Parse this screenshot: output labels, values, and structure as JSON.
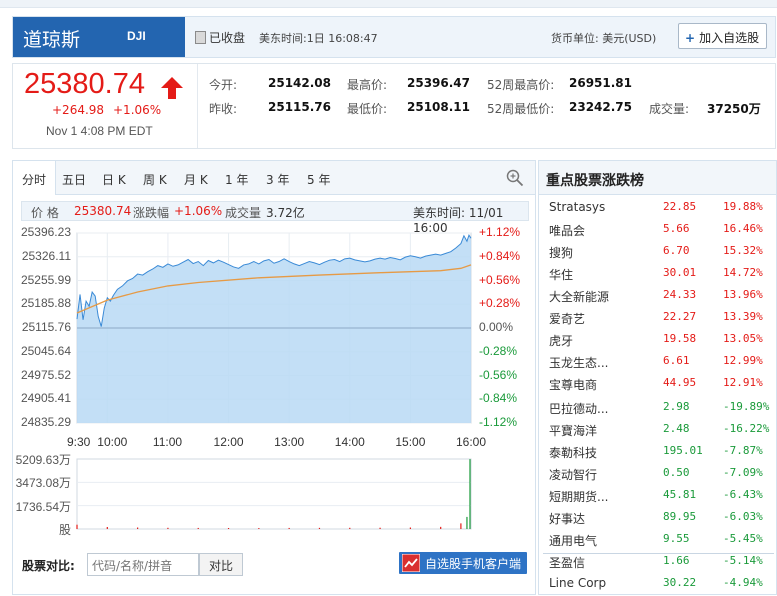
{
  "header": {
    "name": "道琼斯",
    "symbol": "DJI",
    "status": "已收盘",
    "time": "美东时间:1日 16:08:47",
    "currency": "货币单位: 美元(USD)",
    "add_button": "加入自选股"
  },
  "quote": {
    "price": "25380.74",
    "change": "+264.98",
    "change_pct": "+1.06%",
    "date": "Nov 1 4:08 PM EDT",
    "stats": [
      {
        "label": "今开:",
        "value": "25142.08"
      },
      {
        "label": "最高价:",
        "value": "25396.47"
      },
      {
        "label": "52周最高价:",
        "value": "26951.81"
      },
      {
        "label": "昨收:",
        "value": "25115.76"
      },
      {
        "label": "最低价:",
        "value": "25108.11"
      },
      {
        "label": "52周最低价:",
        "value": "23242.75"
      },
      {
        "label": "成交量:",
        "value": "37250万"
      }
    ]
  },
  "tabs": [
    "分时",
    "五日",
    "日 K",
    "周 K",
    "月 K",
    "1 年",
    "3 年",
    "5 年"
  ],
  "infobar": {
    "price_label": "价 格",
    "price": "25380.74",
    "chg_label": "涨跌幅",
    "chg": "+1.06%",
    "vol_label": "成交量",
    "vol": "3.72亿",
    "time": "美东时间: 11/01 16:00"
  },
  "chart_data": {
    "type": "area",
    "x_ticks": [
      "9:30",
      "10:00",
      "11:00",
      "12:00",
      "13:00",
      "14:00",
      "15:00",
      "16:00"
    ],
    "y_ticks": [
      "25396.23",
      "25326.11",
      "25255.99",
      "25185.88",
      "25115.76",
      "25045.64",
      "24975.52",
      "24905.41",
      "24835.29"
    ],
    "pct_ticks": [
      "+1.12%",
      "+0.84%",
      "+0.56%",
      "+0.28%",
      "0.00%",
      "-0.28%",
      "-0.56%",
      "-0.84%",
      "-1.12%"
    ],
    "ylim": [
      24835.29,
      25396.23
    ],
    "prev_close": 25115.76,
    "colors": {
      "up": "#e41b17",
      "down": "#1a9a3a",
      "fill": "#b8d9f5",
      "line": "#3a8ad6",
      "avg": "#e69a45"
    },
    "price_series": [
      {
        "t": 0,
        "v": 25142
      },
      {
        "t": 3,
        "v": 25215
      },
      {
        "t": 6,
        "v": 25140
      },
      {
        "t": 9,
        "v": 25195
      },
      {
        "t": 12,
        "v": 25180
      },
      {
        "t": 15,
        "v": 25222
      },
      {
        "t": 18,
        "v": 25210
      },
      {
        "t": 21,
        "v": 25150
      },
      {
        "t": 24,
        "v": 25120
      },
      {
        "t": 27,
        "v": 25175
      },
      {
        "t": 30,
        "v": 25205
      },
      {
        "t": 33,
        "v": 25195
      },
      {
        "t": 36,
        "v": 25212
      },
      {
        "t": 40,
        "v": 25230
      },
      {
        "t": 45,
        "v": 25240
      },
      {
        "t": 50,
        "v": 25255
      },
      {
        "t": 55,
        "v": 25262
      },
      {
        "t": 60,
        "v": 25275
      },
      {
        "t": 65,
        "v": 25272
      },
      {
        "t": 70,
        "v": 25282
      },
      {
        "t": 75,
        "v": 25290
      },
      {
        "t": 80,
        "v": 25300
      },
      {
        "t": 85,
        "v": 25295
      },
      {
        "t": 90,
        "v": 25305
      },
      {
        "t": 95,
        "v": 25298
      },
      {
        "t": 100,
        "v": 25302
      },
      {
        "t": 105,
        "v": 25310
      },
      {
        "t": 110,
        "v": 25318
      },
      {
        "t": 115,
        "v": 25306
      },
      {
        "t": 120,
        "v": 25312
      },
      {
        "t": 125,
        "v": 25300
      },
      {
        "t": 130,
        "v": 25315
      },
      {
        "t": 135,
        "v": 25308
      },
      {
        "t": 140,
        "v": 25316
      },
      {
        "t": 145,
        "v": 25310
      },
      {
        "t": 150,
        "v": 25303
      },
      {
        "t": 155,
        "v": 25296
      },
      {
        "t": 160,
        "v": 25292
      },
      {
        "t": 165,
        "v": 25302
      },
      {
        "t": 170,
        "v": 25305
      },
      {
        "t": 175,
        "v": 25312
      },
      {
        "t": 180,
        "v": 25305
      },
      {
        "t": 185,
        "v": 25314
      },
      {
        "t": 190,
        "v": 25318
      },
      {
        "t": 195,
        "v": 25307
      },
      {
        "t": 200,
        "v": 25312
      },
      {
        "t": 205,
        "v": 25320
      },
      {
        "t": 210,
        "v": 25312
      },
      {
        "t": 215,
        "v": 25305
      },
      {
        "t": 220,
        "v": 25300
      },
      {
        "t": 225,
        "v": 25306
      },
      {
        "t": 230,
        "v": 25312
      },
      {
        "t": 235,
        "v": 25308
      },
      {
        "t": 240,
        "v": 25303
      },
      {
        "t": 245,
        "v": 25310
      },
      {
        "t": 250,
        "v": 25316
      },
      {
        "t": 255,
        "v": 25318
      },
      {
        "t": 260,
        "v": 25312
      },
      {
        "t": 265,
        "v": 25320
      },
      {
        "t": 270,
        "v": 25322
      },
      {
        "t": 275,
        "v": 25317
      },
      {
        "t": 280,
        "v": 25314
      },
      {
        "t": 285,
        "v": 25311
      },
      {
        "t": 290,
        "v": 25314
      },
      {
        "t": 295,
        "v": 25319
      },
      {
        "t": 300,
        "v": 25322
      },
      {
        "t": 305,
        "v": 25319
      },
      {
        "t": 310,
        "v": 25324
      },
      {
        "t": 315,
        "v": 25321
      },
      {
        "t": 320,
        "v": 25317
      },
      {
        "t": 325,
        "v": 25325
      },
      {
        "t": 330,
        "v": 25329
      },
      {
        "t": 335,
        "v": 25326
      },
      {
        "t": 340,
        "v": 25322
      },
      {
        "t": 345,
        "v": 25328
      },
      {
        "t": 350,
        "v": 25331
      },
      {
        "t": 355,
        "v": 25334
      },
      {
        "t": 360,
        "v": 25331
      },
      {
        "t": 365,
        "v": 25336
      },
      {
        "t": 370,
        "v": 25341
      },
      {
        "t": 375,
        "v": 25352
      },
      {
        "t": 380,
        "v": 25365
      },
      {
        "t": 383,
        "v": 25388
      },
      {
        "t": 386,
        "v": 25372
      },
      {
        "t": 388,
        "v": 25390
      },
      {
        "t": 390,
        "v": 25380.74
      }
    ],
    "avg_series": [
      {
        "t": 0,
        "v": 25160
      },
      {
        "t": 30,
        "v": 25198
      },
      {
        "t": 60,
        "v": 25222
      },
      {
        "t": 90,
        "v": 25240
      },
      {
        "t": 120,
        "v": 25250
      },
      {
        "t": 180,
        "v": 25264
      },
      {
        "t": 240,
        "v": 25272
      },
      {
        "t": 300,
        "v": 25279
      },
      {
        "t": 360,
        "v": 25285
      },
      {
        "t": 380,
        "v": 25292
      },
      {
        "t": 390,
        "v": 25302
      }
    ],
    "volume_ticks": [
      "5209.63万",
      "3473.08万",
      "1736.54万",
      "股"
    ],
    "volume_max": 5209.63,
    "volume_series": [
      {
        "t": 0,
        "v": 320
      },
      {
        "t": 30,
        "v": 150
      },
      {
        "t": 60,
        "v": 110
      },
      {
        "t": 90,
        "v": 90
      },
      {
        "t": 120,
        "v": 80
      },
      {
        "t": 150,
        "v": 75
      },
      {
        "t": 180,
        "v": 70
      },
      {
        "t": 210,
        "v": 80
      },
      {
        "t": 240,
        "v": 85
      },
      {
        "t": 270,
        "v": 90
      },
      {
        "t": 300,
        "v": 95
      },
      {
        "t": 330,
        "v": 110
      },
      {
        "t": 360,
        "v": 160
      },
      {
        "t": 380,
        "v": 420
      },
      {
        "t": 386,
        "v": 900
      },
      {
        "t": 389,
        "v": 5200
      }
    ]
  },
  "compare": {
    "label": "股票对比:",
    "placeholder": "代码/名称/拼音",
    "button": "对比",
    "app_button": "自选股手机客户端"
  },
  "movers": {
    "title": "重点股票涨跌榜",
    "gainers": [
      {
        "name": "Stratasys",
        "price": "22.85",
        "chg": "19.88%"
      },
      {
        "name": "唯品会",
        "price": "5.66",
        "chg": "16.46%"
      },
      {
        "name": "搜狗",
        "price": "6.70",
        "chg": "15.32%"
      },
      {
        "name": "华住",
        "price": "30.01",
        "chg": "14.72%"
      },
      {
        "name": "大全新能源",
        "price": "24.33",
        "chg": "13.96%"
      },
      {
        "name": "爱奇艺",
        "price": "22.27",
        "chg": "13.39%"
      },
      {
        "name": "虎牙",
        "price": "19.58",
        "chg": "13.05%"
      },
      {
        "name": "玉龙生态...",
        "price": "6.61",
        "chg": "12.99%"
      },
      {
        "name": "宝尊电商",
        "price": "44.95",
        "chg": "12.91%"
      }
    ],
    "losers": [
      {
        "name": "巴拉德动...",
        "price": "2.98",
        "chg": "-19.89%"
      },
      {
        "name": "平寶海洋",
        "price": "2.48",
        "chg": "-16.22%"
      },
      {
        "name": "泰勒科技",
        "price": "195.01",
        "chg": "-7.87%"
      },
      {
        "name": "凌动智行",
        "price": "0.50",
        "chg": "-7.09%"
      },
      {
        "name": "短期期货...",
        "price": "45.81",
        "chg": "-6.43%"
      },
      {
        "name": "好事达",
        "price": "89.95",
        "chg": "-6.03%"
      },
      {
        "name": "通用电气",
        "price": "9.55",
        "chg": "-5.45%"
      },
      {
        "name": "圣盈信",
        "price": "1.66",
        "chg": "-5.14%"
      },
      {
        "name": "Line Corp",
        "price": "30.22",
        "chg": "-4.94%"
      }
    ]
  }
}
